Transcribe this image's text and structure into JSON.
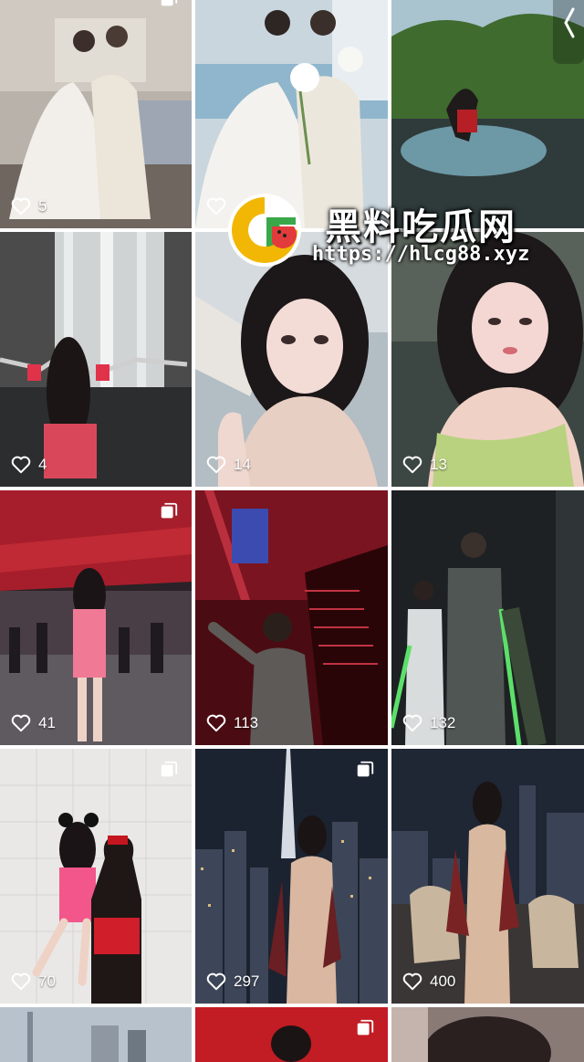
{
  "watermark": {
    "title": "黑料吃瓜网",
    "url": "https://hlcg88.xyz"
  },
  "grid": {
    "posts": [
      {
        "likes": "5",
        "multi": false
      },
      {
        "likes": "",
        "multi": false
      },
      {
        "likes": "",
        "multi": false
      },
      {
        "likes": "4",
        "multi": false
      },
      {
        "likes": "14",
        "multi": false
      },
      {
        "likes": "13",
        "multi": false
      },
      {
        "likes": "41",
        "multi": true
      },
      {
        "likes": "113",
        "multi": false
      },
      {
        "likes": "132",
        "multi": false
      },
      {
        "likes": "70",
        "multi": true
      },
      {
        "likes": "297",
        "multi": true
      },
      {
        "likes": "400",
        "multi": false
      },
      {
        "likes": "",
        "multi": false
      },
      {
        "likes": "",
        "multi": true
      },
      {
        "likes": "",
        "multi": false
      }
    ]
  },
  "icons": {
    "like": "heart-outline-icon",
    "multi": "multiple-images-icon",
    "back": "chevron-left-icon"
  },
  "colors": {
    "logo_yellow": "#f2b705",
    "logo_green": "#3aa84a",
    "logo_red": "#e23b3b"
  }
}
